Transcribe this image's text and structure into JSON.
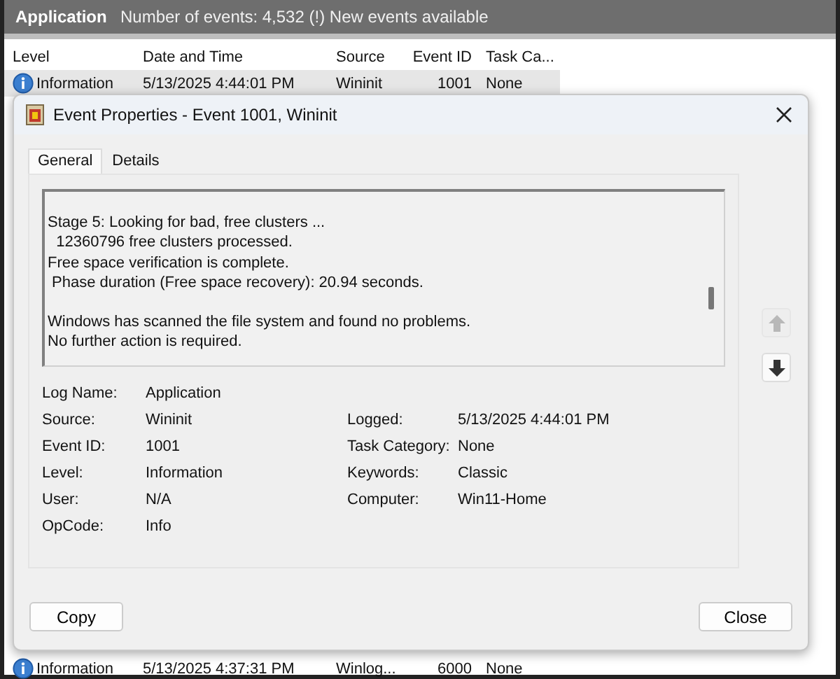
{
  "header": {
    "title": "Application",
    "info": "Number of events: 4,532 (!) New events available"
  },
  "table": {
    "columns": [
      "Level",
      "Date and Time",
      "Source",
      "Event ID",
      "Task Ca..."
    ],
    "rows": [
      {
        "selected": true,
        "cells": [
          "Information",
          "5/13/2025 4:44:01 PM",
          "Wininit",
          "1001",
          "None"
        ]
      },
      {
        "selected": false,
        "cells": [
          "Information",
          "5/13/2025 4:37:31 PM",
          "Winlog...",
          "6000",
          "None"
        ]
      }
    ]
  },
  "dialog": {
    "title": "Event Properties - Event 1001, Wininit",
    "tabs": [
      {
        "label": "General",
        "selected": true
      },
      {
        "label": "Details",
        "selected": false
      }
    ],
    "message": [
      [
        "Stage 5: Looking for bad, free clusters ...",
        "  12360796 free clusters processed.",
        "Free space verification is complete.",
        " Phase duration (Free space recovery): 20.94 seconds."
      ],
      [
        "Windows has scanned the file system and found no problems.",
        "No further action is required."
      ]
    ],
    "nav": [
      {
        "kind": "up",
        "disabled": true
      },
      {
        "kind": "down",
        "disabled": false
      }
    ],
    "fields_left": [
      {
        "label": "Log Name:",
        "value": "Application"
      },
      {
        "label": "Source:",
        "value": "Wininit"
      },
      {
        "label": "Event ID:",
        "value": "1001"
      },
      {
        "label": "Level:",
        "value": "Information"
      },
      {
        "label": "User:",
        "value": "N/A"
      },
      {
        "label": "OpCode:",
        "value": "Info"
      }
    ],
    "fields_right": [
      {
        "label": "Logged:",
        "value": "5/13/2025 4:44:01 PM"
      },
      {
        "label": "Task Category:",
        "value": "None"
      },
      {
        "label": "Keywords:",
        "value": "Classic"
      },
      {
        "label": "Computer:",
        "value": "Win11-Home"
      }
    ],
    "buttons": [
      "Copy",
      "Close"
    ]
  }
}
